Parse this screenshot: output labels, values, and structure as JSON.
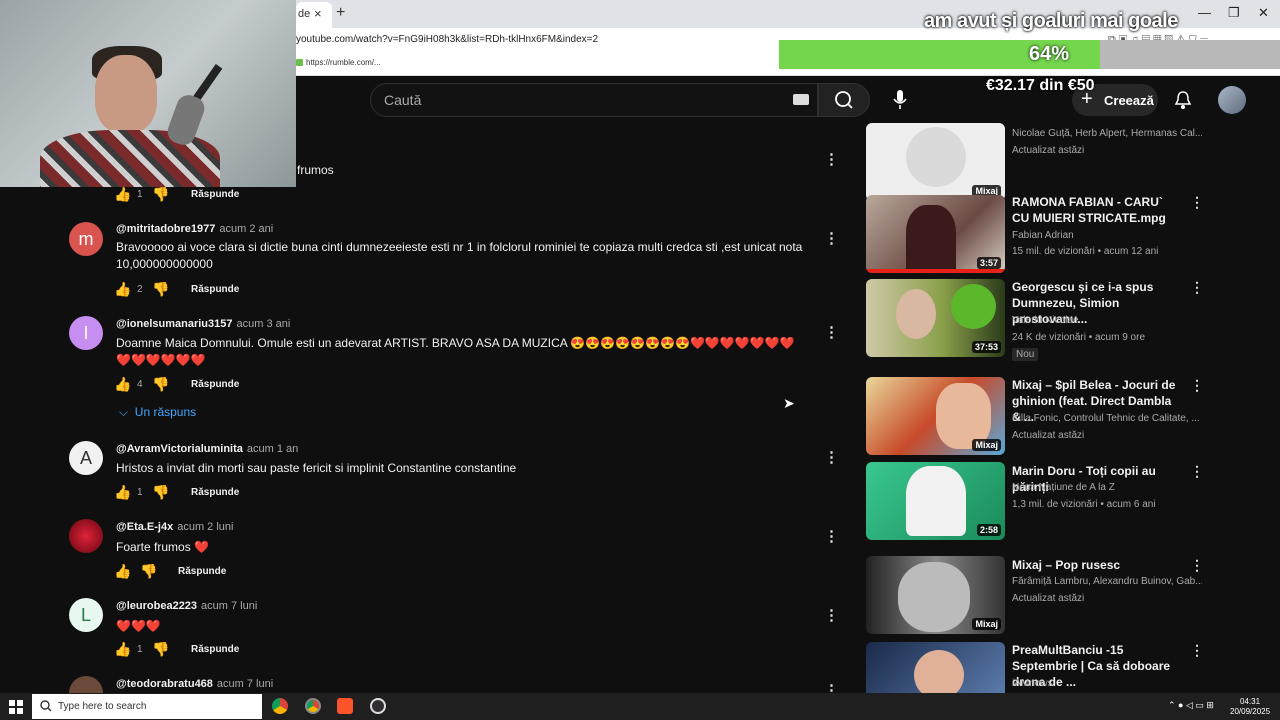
{
  "browser": {
    "tab_label": "de",
    "tab_close": "×",
    "new_tab": "+",
    "url": "youtube.com/watch?v=FnG9iH08h3k&list=RDh-tklHnx6FM&index=2",
    "bookmark": "https://rumble.com/...",
    "minimize": "—",
    "restore": "❐",
    "close": "✕"
  },
  "overlay": {
    "goal_text": "am avut și goaluri mai goale",
    "percent_label": "64%",
    "progress_fraction": 0.64,
    "amount": "€32.17 din €50"
  },
  "header": {
    "search_placeholder": "Caută",
    "create_label": "Creează",
    "create_plus": "+",
    "bell": "🔔"
  },
  "comments": {
    "partial_text": "frumos",
    "partial_likes": "1",
    "reply_label": "Răspunde",
    "items": [
      {
        "avatar_letter": "m",
        "avatar_color": "#d9534f",
        "user": "@mitritadobre1977",
        "time": "acum 2 ani",
        "text": "Bravooooo ai voce clara si dictie buna cinti dumnezeeieste esti nr 1 in folclorul rominiei te copiaza multi credca sti   ,est unicat nota 10,000000000000",
        "likes": "2"
      },
      {
        "avatar_letter": "I",
        "avatar_color": "#c68ef0",
        "user": "@ionelsumanariu3157",
        "time": "acum 3 ani",
        "text": "Doamne Maica Domnului. Omule esti un adevarat ARTIST. BRAVO  ASA DA MUZICA 😍😍😍😍😍😍😍😍❤️❤️❤️❤️❤️❤️❤️❤️❤️❤️❤️❤️❤️",
        "likes": "4"
      },
      {
        "avatar_letter": "A",
        "avatar_color": "#f1f1f1",
        "user": "@AvramVictorialuminita",
        "time": "acum 1 an",
        "text": "Hristos a inviat din morti sau paste fericit si implinit Constantine constantine",
        "likes": "1"
      },
      {
        "avatar_letter": "",
        "avatar_color": "#c0182a",
        "user": "@Eta.E-j4x",
        "time": "acum 2 luni",
        "text": "Foarte frumos ❤️",
        "likes": ""
      },
      {
        "avatar_letter": "L",
        "avatar_color": "#e8f7ef",
        "user": "@leurobea2223",
        "time": "acum 7 luni",
        "text": "❤️❤️❤️",
        "likes": "1"
      },
      {
        "avatar_letter": "",
        "avatar_color": "#6b4a3a",
        "user": "@teodorabratu468",
        "time": "acum 7 luni",
        "text": "",
        "likes": ""
      }
    ],
    "replies_link": "Un răspuns"
  },
  "sidebar": {
    "videos": [
      {
        "title": "",
        "meta1": "Nicolae Guță, Herb Alpert, Hermanas Cal...",
        "meta2": "Actualizat astăzi",
        "badge": "Mixaj",
        "thumb_color": "#eeeeee"
      },
      {
        "title": "RAMONA FABIAN - CARU` CU MUIERI STRICATE.mpg",
        "meta1": "Fabian Adrian",
        "meta2": "15 mil. de vizionări • acum 12 ani",
        "badge": "3:57",
        "thumb_color": "#8a6e6a"
      },
      {
        "title": "Georgescu și ce i-a spus Dumnezeu, Simion prostovanu...",
        "meta1": "Valeriu Nicolae",
        "meta2": "24 K de vizionări • acum 9 ore",
        "badge": "37:53",
        "new_label": "Nou",
        "thumb_color": "#5c7a2a"
      },
      {
        "title": "Mixaj – $pil Belea - Jocuri de ghinion (feat. Direct Dambla & ...",
        "meta1": "Killa Fonic, Controlul Tehnic de Calitate, ...",
        "meta2": "Actualizat astăzi",
        "badge": "Mixaj",
        "thumb_color": "#c89a3a"
      },
      {
        "title": "Marin Doru - Toți copii au părinți",
        "meta1": "Noua Națiune de A la Z",
        "meta2": "1,3 mil. de vizionări • acum 6 ani",
        "badge": "2:58",
        "thumb_color": "#2aa870"
      },
      {
        "title": "Mixaj – Pop rusesc",
        "meta1": "Fărâmiță Lambru, Alexandru Buinov, Gab...",
        "meta2": "Actualizat astăzi",
        "badge": "Mixaj",
        "thumb_color": "#555555"
      },
      {
        "title": "PreaMultBanciu -15 Septembrie | Ca să doboare drona de ...",
        "meta1": "iAMnews",
        "meta2": "",
        "badge": "",
        "thumb_color": "#3a5a8a"
      }
    ]
  },
  "taskbar": {
    "search_text": "Type here to search",
    "time": "04:31",
    "date": "20/09/2025"
  }
}
